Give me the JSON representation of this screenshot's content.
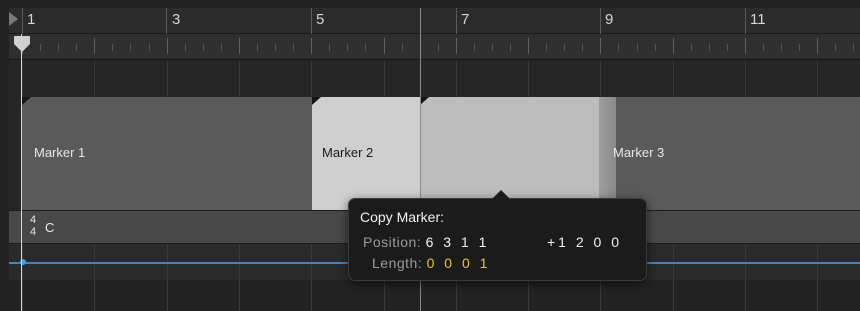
{
  "ruler": {
    "bars": [
      "1",
      "3",
      "5",
      "7",
      "9",
      "11"
    ]
  },
  "markers": [
    {
      "label": "Marker 1"
    },
    {
      "label": "Marker 2"
    },
    {
      "label": "Marker 3"
    }
  ],
  "signature": {
    "time_numerator": "4",
    "time_denominator": "4",
    "key": "C"
  },
  "tooltip": {
    "title": "Copy Marker:",
    "position_label": "Position:",
    "position_value": "6 3 1 1",
    "offset_value": "+1 2 0 0",
    "length_label": "Length:",
    "length_value": "0 0 0 1"
  },
  "colors": {
    "tempo_line": "#3a86c9",
    "length_accent": "#e8c23a",
    "selected_marker": "#cfcfcf"
  }
}
